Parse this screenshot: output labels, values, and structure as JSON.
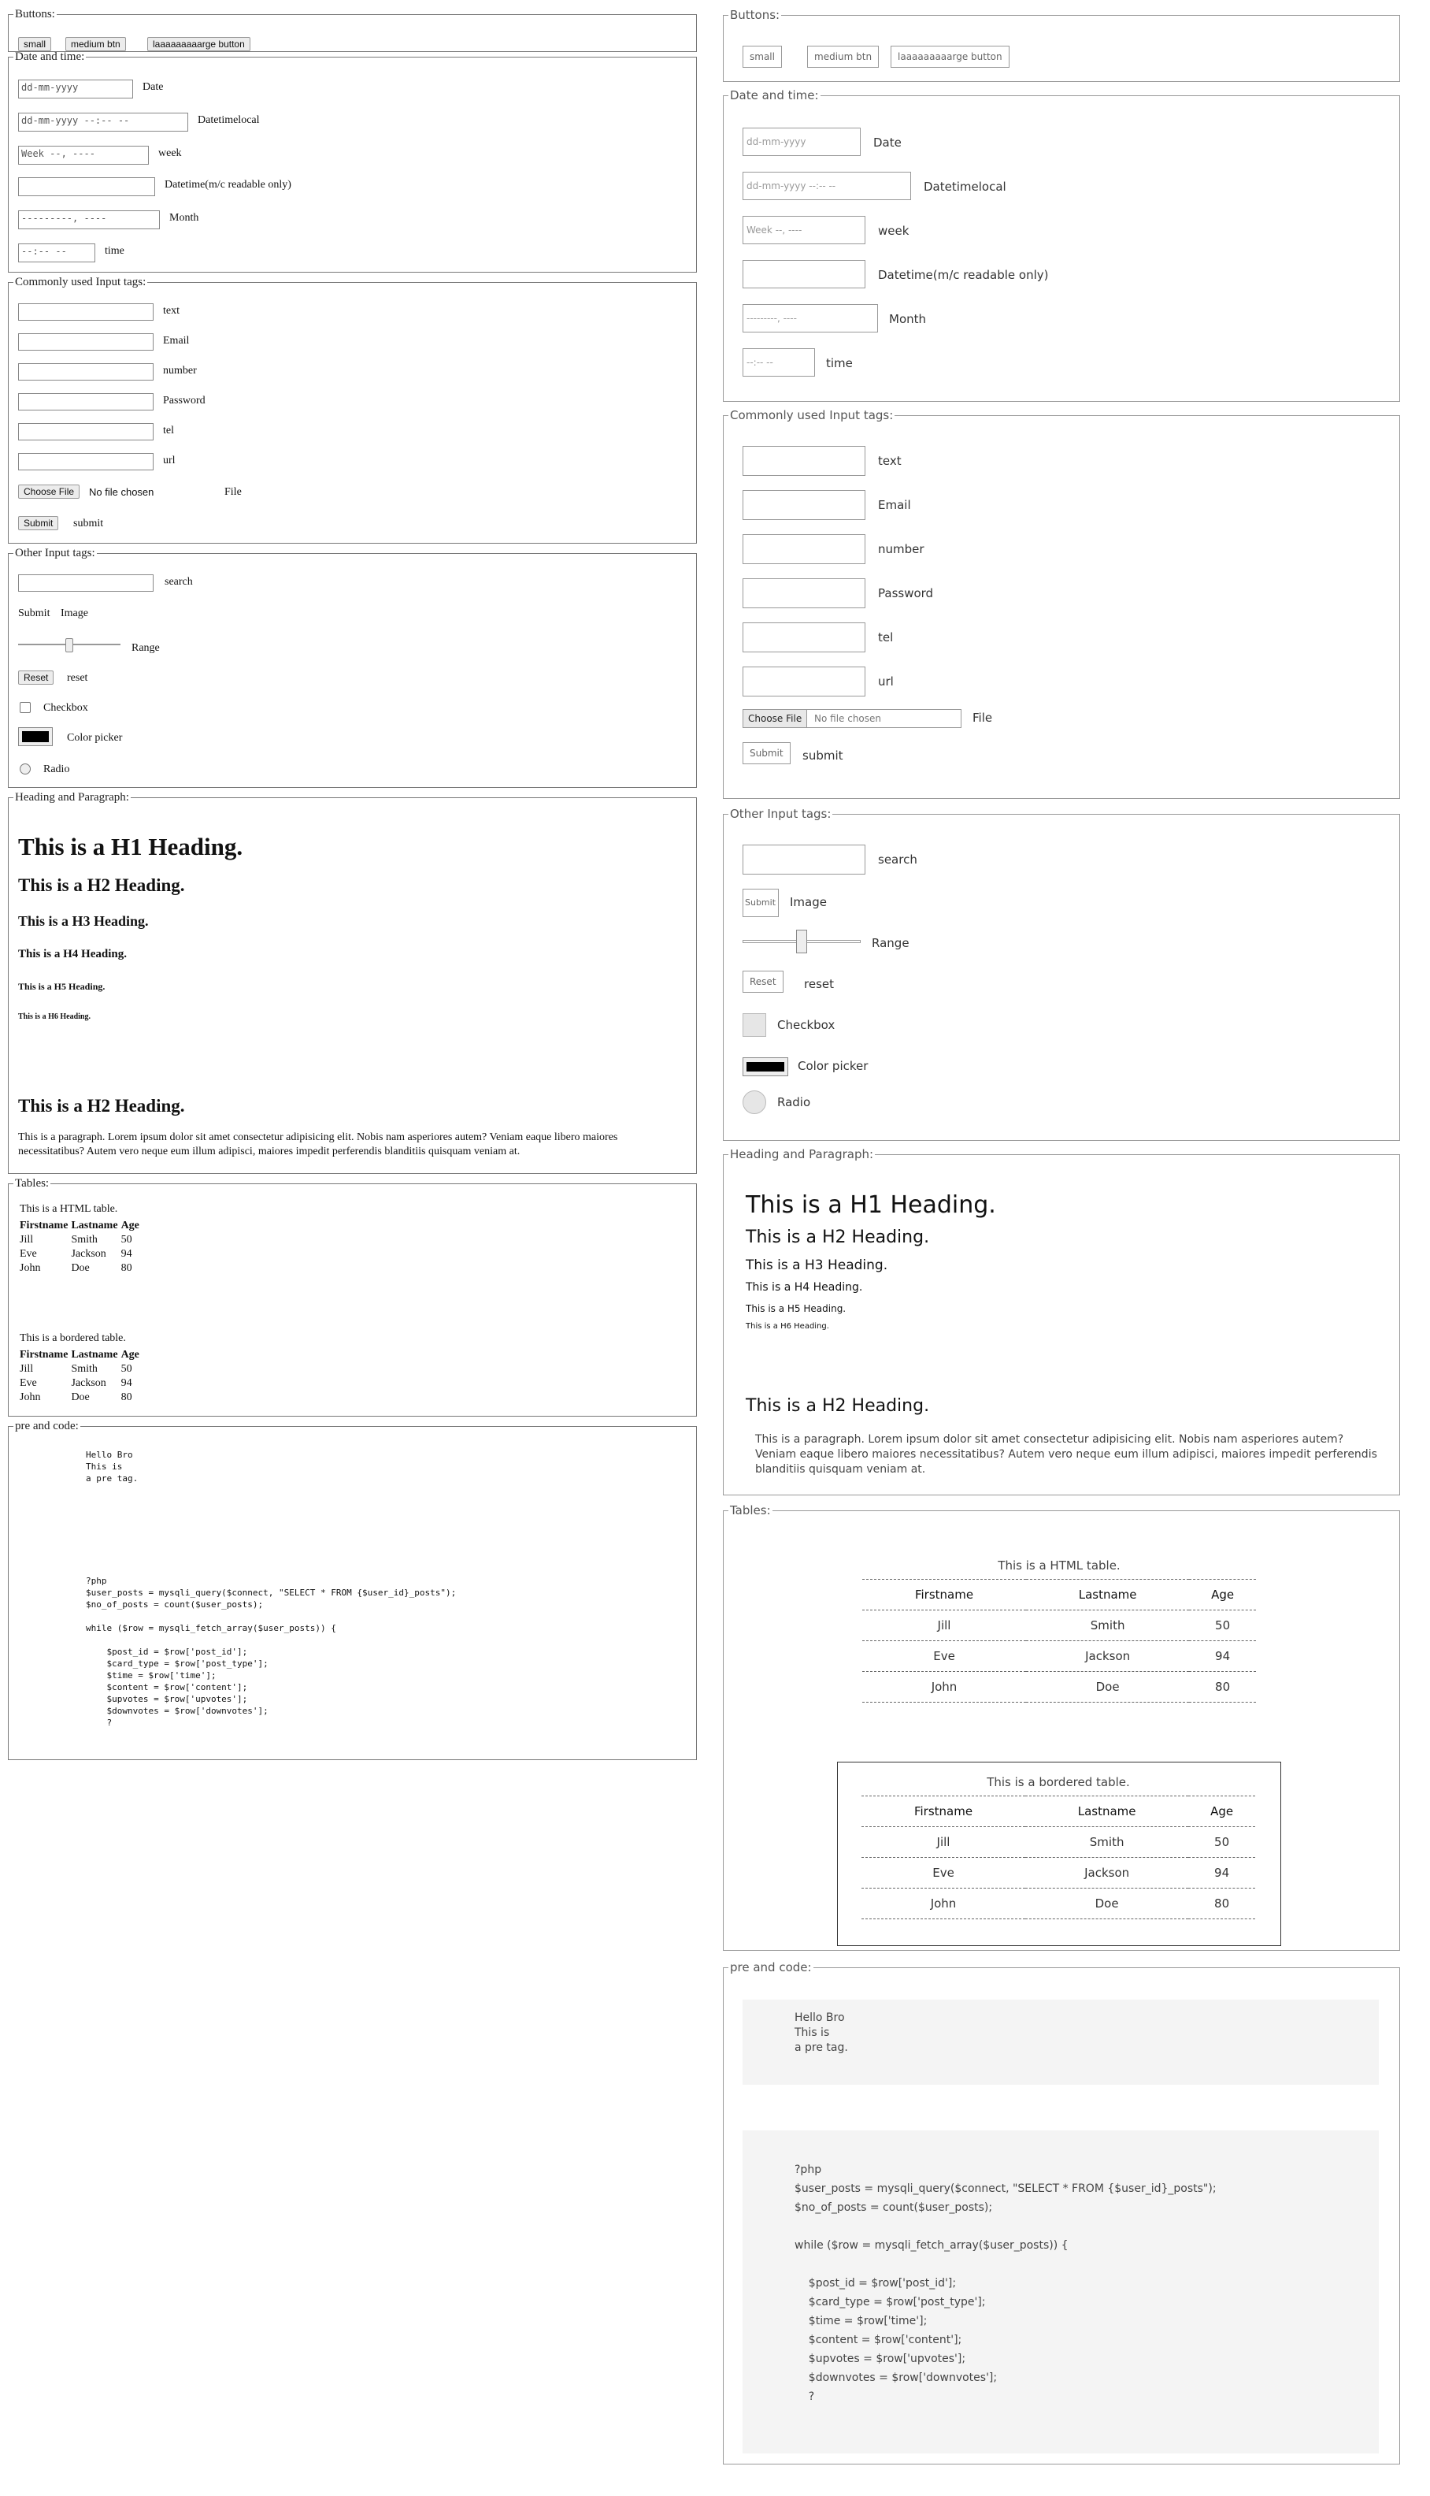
{
  "buttons": {
    "legend": "Buttons:",
    "small": "small",
    "medium": "medium btn",
    "large": "laaaaaaaaarge button"
  },
  "datetime": {
    "legend": "Date and time:",
    "date_placeholder": "dd-mm-yyyy",
    "date_label": "Date",
    "dtlocal_placeholder": "dd-mm-yyyy --:-- --",
    "dtlocal_label": "Datetimelocal",
    "week_placeholder": "Week --, ----",
    "week_label": "week",
    "datetime_label": "Datetime(m/c readable only)",
    "month_placeholder": "---------, ----",
    "month_label": "Month",
    "time_placeholder": "--:-- --",
    "time_label": "time"
  },
  "common": {
    "legend": "Commonly used Input tags:",
    "text_label": "text",
    "email_label": "Email",
    "number_label": "number",
    "password_label": "Password",
    "tel_label": "tel",
    "url_label": "url",
    "choose_file": "Choose File",
    "no_file": "No file chosen",
    "file_label": "File",
    "submit_btn": "Submit",
    "submit_label": "submit"
  },
  "other": {
    "legend": "Other Input tags:",
    "search_label": "search",
    "image_btn": "Submit",
    "image_label": "Image",
    "range_label": "Range",
    "range_value": 0.5,
    "reset_btn": "Reset",
    "reset_label": "reset",
    "checkbox_label": "Checkbox",
    "color_label": "Color picker",
    "color_value": "#000000",
    "radio_label": "Radio"
  },
  "headings": {
    "legend": "Heading and Paragraph:",
    "h1": "This is a H1 Heading.",
    "h2": "This is a H2 Heading.",
    "h3": "This is a H3 Heading.",
    "h4": "This is a H4 Heading.",
    "h5": "This is a H5 Heading.",
    "h6": "This is a H6 Heading.",
    "h2b": "This is a H2 Heading.",
    "paragraph": "This is a paragraph. Lorem ipsum dolor sit amet consectetur adipisicing elit. Nobis nam asperiores autem? Veniam eaque libero maiores necessitatibus? Autem vero neque eum illum adipisci, maiores impedit perferendis blanditiis quisquam veniam at."
  },
  "tables": {
    "legend": "Tables:",
    "caption1": "This is a HTML table.",
    "caption2": "This is a bordered table.",
    "headers": [
      "Firstname",
      "Lastname",
      "Age"
    ],
    "rows": [
      [
        "Jill",
        "Smith",
        "50"
      ],
      [
        "Eve",
        "Jackson",
        "94"
      ],
      [
        "John",
        "Doe",
        "80"
      ]
    ]
  },
  "pre": {
    "legend": "pre and code:",
    "pre1": "Hello Bro\nThis is\na pre tag.",
    "pre2": "?php\n$user_posts = mysqli_query($connect, \"SELECT * FROM {$user_id}_posts\");\n$no_of_posts = count($user_posts);\n\nwhile ($row = mysqli_fetch_array($user_posts)) {\n\n    $post_id = $row['post_id'];\n    $card_type = $row['post_type'];\n    $time = $row['time'];\n    $content = $row['content'];\n    $upvotes = $row['upvotes'];\n    $downvotes = $row['downvotes'];\n    ?"
  },
  "colors": {
    "border": "#777777",
    "button_bg": "#ececec",
    "pre_bg": "#f4f4f4"
  }
}
